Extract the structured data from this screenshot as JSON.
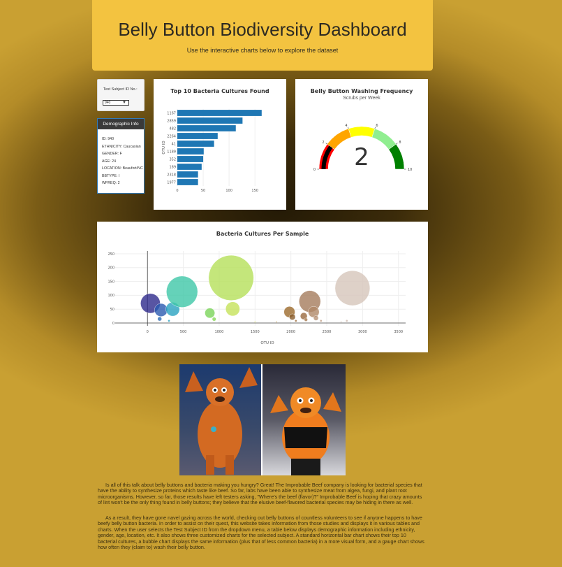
{
  "header": {
    "title": "Belly Button Biodiversity Dashboard",
    "subtitle": "Use the interactive charts below to explore the dataset"
  },
  "selector": {
    "label": "Test Subject ID No.:",
    "selected": "940"
  },
  "demographics": {
    "title": "Demographic Info",
    "lines": [
      "ID: 940",
      "ETHNICITY: Caucasian",
      "GENDER: F",
      "AGE: 24",
      "LOCATION: Beaufort/NC",
      "BBTYPE: I",
      "WFREQ: 2"
    ]
  },
  "bar_card": {
    "title": "Top 10 Bacteria Cultures Found"
  },
  "gauge_card": {
    "title": "Belly Button Washing Frequency",
    "subtitle": "Scrubs per Week",
    "value_text": "2"
  },
  "bubble_card": {
    "title": "Bacteria Cultures Per Sample"
  },
  "chart_data": [
    {
      "type": "bar",
      "orientation": "horizontal",
      "title": "Top 10 Bacteria Cultures Found",
      "ylabel": "OTU ID",
      "categories": [
        "1167",
        "2859",
        "482",
        "2264",
        "41",
        "1189",
        "352",
        "189",
        "2318",
        "1977"
      ],
      "values": [
        163,
        126,
        113,
        78,
        71,
        51,
        50,
        47,
        40,
        40
      ],
      "xticks": [
        "0",
        "50",
        "100",
        "150"
      ],
      "xlim": [
        0,
        170
      ],
      "color": "#1f77b4"
    },
    {
      "type": "gauge",
      "title": "Belly Button Washing Frequency",
      "subtitle": "Scrubs per Week",
      "value": 2,
      "range": [
        0,
        10
      ],
      "tick_labels": [
        "0",
        "2",
        "4",
        "6",
        "8",
        "10"
      ],
      "bands": [
        {
          "from": 0,
          "to": 2,
          "color": "#ff0000"
        },
        {
          "from": 2,
          "to": 4,
          "color": "#ffa500"
        },
        {
          "from": 4,
          "to": 6,
          "color": "#ffff00"
        },
        {
          "from": 6,
          "to": 8,
          "color": "#90ee90"
        },
        {
          "from": 8,
          "to": 10,
          "color": "#008000"
        }
      ],
      "bar_color": "#000000"
    },
    {
      "type": "scatter",
      "title": "Bacteria Cultures Per Sample",
      "xlabel": "OTU ID",
      "xlim": [
        -450,
        3600
      ],
      "ylim": [
        -10,
        260
      ],
      "xticks": [
        "0",
        "500",
        "1000",
        "1500",
        "2000",
        "2500",
        "3000",
        "3500"
      ],
      "xtick_values": [
        0,
        500,
        1000,
        1500,
        2000,
        2500,
        3000,
        3500
      ],
      "yticks": [
        "0",
        "50",
        "100",
        "150",
        "200",
        "250"
      ],
      "ytick_values": [
        0,
        50,
        100,
        150,
        200,
        250
      ],
      "points": [
        {
          "x": 41,
          "y": 71,
          "color": "#2e2a8c"
        },
        {
          "x": 189,
          "y": 47,
          "color": "#2a5ab0"
        },
        {
          "x": 352,
          "y": 50,
          "color": "#2aa3c0"
        },
        {
          "x": 482,
          "y": 113,
          "color": "#3fc7a8"
        },
        {
          "x": 170,
          "y": 15,
          "color": "#2a6ab4"
        },
        {
          "x": 300,
          "y": 8,
          "color": "#2aa3c0"
        },
        {
          "x": 870,
          "y": 36,
          "color": "#7ad45a"
        },
        {
          "x": 930,
          "y": 14,
          "color": "#8ad85a"
        },
        {
          "x": 1167,
          "y": 163,
          "color": "#b5e05a"
        },
        {
          "x": 1189,
          "y": 51,
          "color": "#c6e25a"
        },
        {
          "x": 1500,
          "y": 4,
          "color": "#dce060"
        },
        {
          "x": 1800,
          "y": 4,
          "color": "#c8a050"
        },
        {
          "x": 1980,
          "y": 40,
          "color": "#9c6a2c"
        },
        {
          "x": 2020,
          "y": 22,
          "color": "#8a5c2a"
        },
        {
          "x": 2070,
          "y": 8,
          "color": "#a07040"
        },
        {
          "x": 2180,
          "y": 25,
          "color": "#9a6a40"
        },
        {
          "x": 2210,
          "y": 12,
          "color": "#a67a50"
        },
        {
          "x": 2264,
          "y": 78,
          "color": "#a57c5c"
        },
        {
          "x": 2318,
          "y": 40,
          "color": "#b08868"
        },
        {
          "x": 2350,
          "y": 18,
          "color": "#b89478"
        },
        {
          "x": 2420,
          "y": 8,
          "color": "#c0a088"
        },
        {
          "x": 2700,
          "y": 4,
          "color": "#c8b0a0"
        },
        {
          "x": 2780,
          "y": 8,
          "color": "#d0bcb0"
        },
        {
          "x": 2859,
          "y": 126,
          "color": "#d6c6ba"
        }
      ],
      "sizes": [
        71,
        47,
        50,
        113,
        15,
        8,
        36,
        14,
        163,
        51,
        4,
        4,
        40,
        22,
        8,
        25,
        12,
        78,
        40,
        18,
        8,
        4,
        8,
        126
      ]
    }
  ],
  "photos": {
    "left_alt": "Gritty mascot",
    "right_alt": "Gritty mascot"
  },
  "paragraphs": [
    "Is all of this talk about belly buttons and bacteria making you hungry? Great! The Improbable Beef company is looking for bacterial species that have the ability to synthesize proteins which taste like beef. So far, labs have been able to synthesize meat from algea, fungi, and plant root microorganisms. However, so far, those results have left testers asking, \"Where's the beef (flavor)?\" Improbable Beef is hoping that crazy amounts of lint won't be the only thing found in belly buttons; they believe that the elusive beef-flavored bacterial species may be hiding in there as well.",
    "As a result, they have gone navel gazing across the world, checking out belly buttons of countless volunteers to see if anyone happens to have beefy belly button bacteria. In order to assist on their quest, this website takes information from those studies and displays it in various tables and charts. When the user selects the Test Subject ID from the dropdown menu, a table below displays demographic information including ethnicity, gender, age, location, etc. It also shows three customized charts for the selected subject. A standard horizontal bar chart shows their top 10 bacterial cultures, a bubble chart displays the same information (plus that of less common bacteria) in a more visual form, and a gauge chart shows how often they (claim to) wash their belly button."
  ]
}
